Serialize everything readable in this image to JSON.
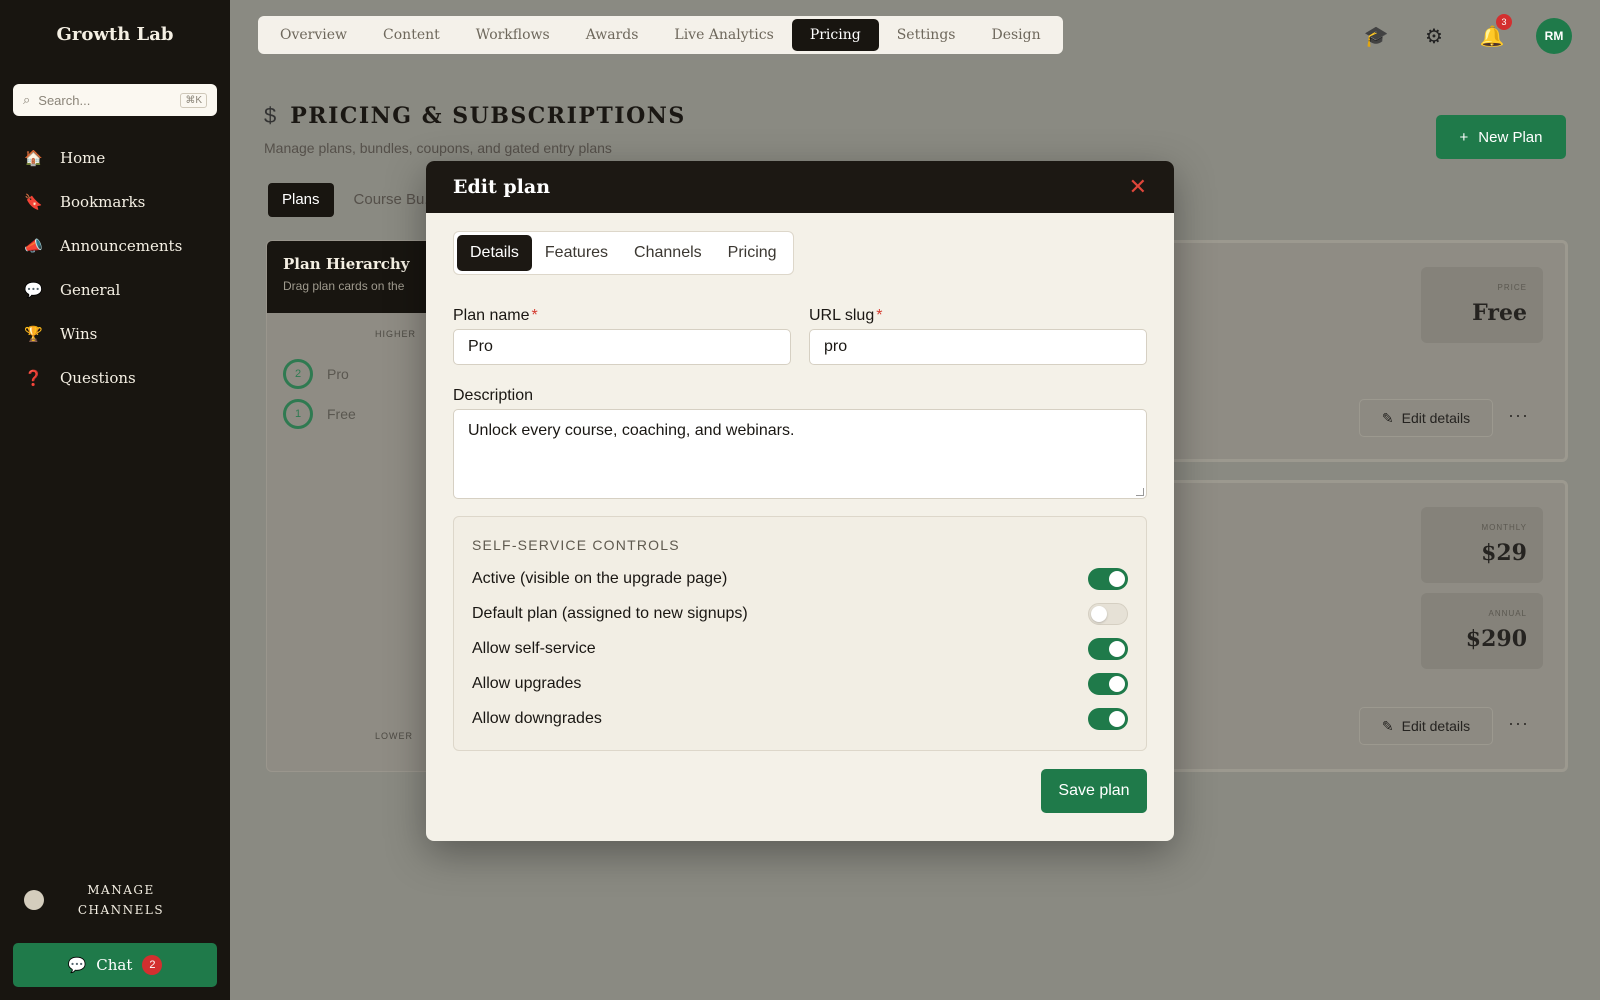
{
  "sidebar": {
    "brand": "Growth Lab",
    "search_placeholder": "Search...",
    "search_kbd": "⌘K",
    "items": [
      {
        "icon": "home-icon",
        "glyph": "🏠",
        "label": "Home"
      },
      {
        "icon": "bookmark-icon",
        "glyph": "🔖",
        "label": "Bookmarks"
      },
      {
        "icon": "megaphone-icon",
        "glyph": "📣",
        "label": "Announcements"
      },
      {
        "icon": "chat-bubble-icon",
        "glyph": "💬",
        "label": "General"
      },
      {
        "icon": "trophy-icon",
        "glyph": "🏆",
        "label": "Wins"
      },
      {
        "icon": "question-icon",
        "glyph": "❓",
        "label": "Questions"
      }
    ],
    "manage_label": "MANAGE CHANNELS",
    "chat_label": "Chat",
    "chat_badge": "2"
  },
  "topnav": {
    "tabs": [
      "Overview",
      "Content",
      "Workflows",
      "Awards",
      "Live Analytics",
      "Pricing",
      "Settings",
      "Design"
    ],
    "active": "Pricing",
    "notif_badge": "3",
    "avatar_initials": "RM"
  },
  "page": {
    "title": "PRICING & SUBSCRIPTIONS",
    "subtitle": "Manage plans, bundles, coupons, and gated entry plans",
    "new_plan_label": "New Plan",
    "tabs": [
      "Plans",
      "Course Bu..."
    ],
    "hierarchy": {
      "title": "Plan Hierarchy",
      "subtitle": "Drag plan cards on the",
      "top_label": "HIGHER",
      "bottom_label": "LOWER",
      "nodes": [
        {
          "num": "2",
          "label": "Pro"
        },
        {
          "num": "1",
          "label": "Free"
        }
      ]
    },
    "cards": [
      {
        "prices": [
          {
            "label": "PRICE",
            "value": "Free"
          }
        ],
        "edit_label": "Edit details"
      },
      {
        "prices": [
          {
            "label": "MONTHLY",
            "value": "$29"
          },
          {
            "label": "ANNUAL",
            "value": "$290"
          }
        ],
        "edit_label": "Edit details"
      }
    ]
  },
  "modal": {
    "title": "Edit plan",
    "tabs": [
      "Details",
      "Features",
      "Channels",
      "Pricing"
    ],
    "active_tab": "Details",
    "plan_name_label": "Plan name",
    "plan_name_value": "Pro",
    "slug_label": "URL slug",
    "slug_value": "pro",
    "description_label": "Description",
    "description_value": "Unlock every course, coaching, and webinars.",
    "controls_heading": "SELF-SERVICE CONTROLS",
    "controls": [
      {
        "label": "Active (visible on the upgrade page)",
        "on": true
      },
      {
        "label": "Default plan (assigned to new signups)",
        "on": false
      },
      {
        "label": "Allow self-service",
        "on": true
      },
      {
        "label": "Allow upgrades",
        "on": true
      },
      {
        "label": "Allow downgrades",
        "on": true
      }
    ],
    "save_label": "Save plan"
  },
  "colors": {
    "accent": "#1f7a4a",
    "danger": "#d43a2f",
    "dark": "#1c1813"
  }
}
